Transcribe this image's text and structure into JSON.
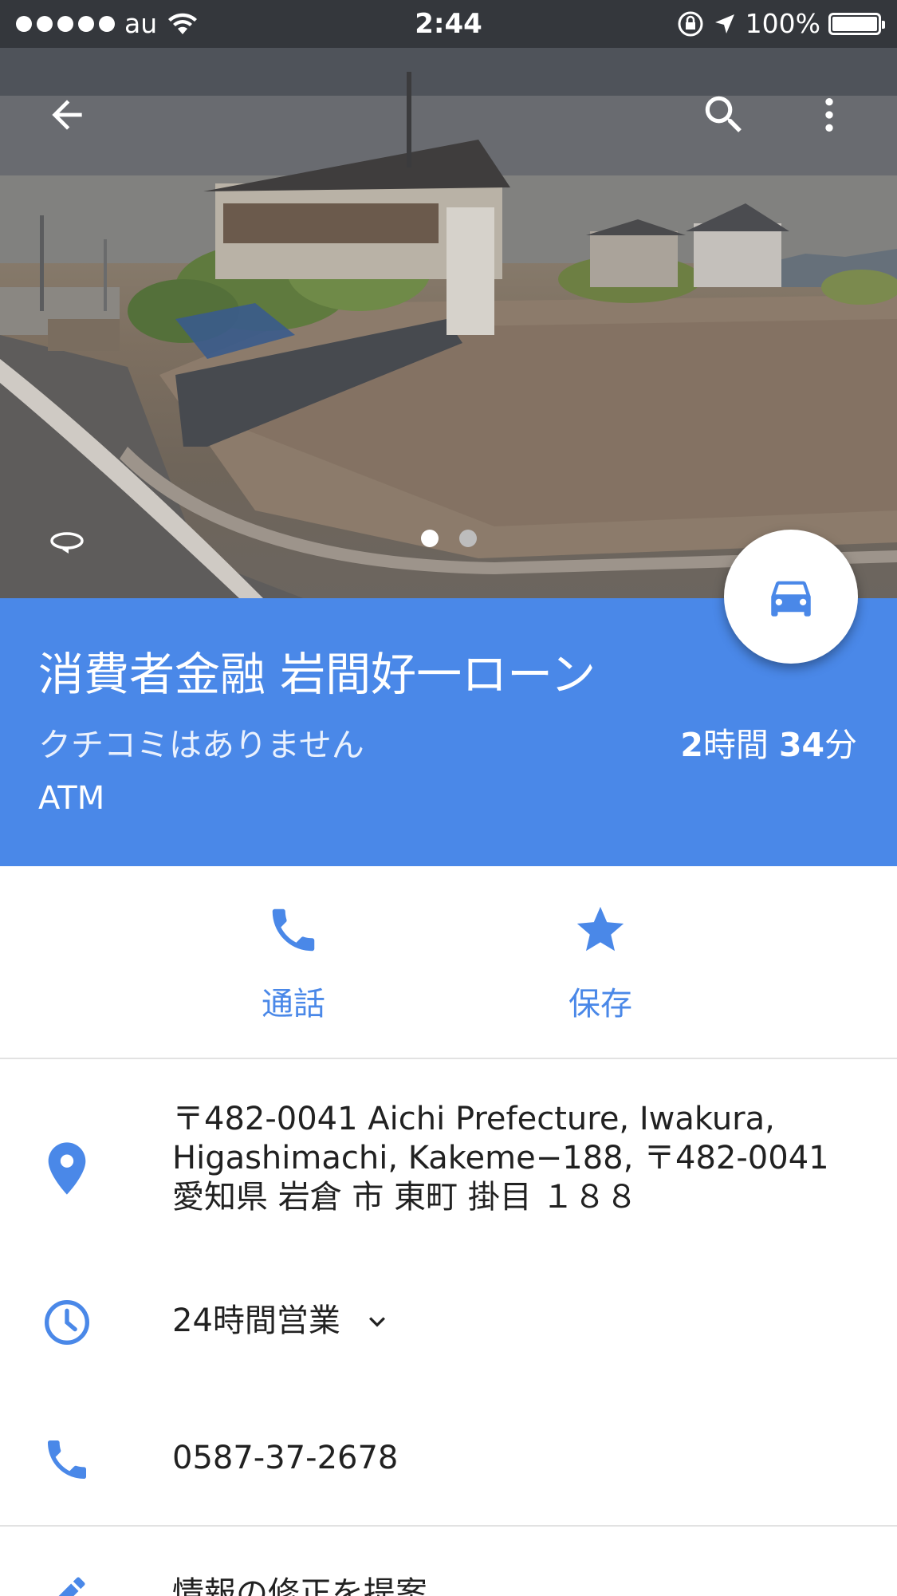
{
  "status_bar": {
    "carrier": "au",
    "time": "2:44",
    "battery_pct": "100%"
  },
  "hero": {
    "page_count": 2,
    "active_page": 0,
    "dot_active_color": "#ffffff",
    "dot_inactive_color": "#bdbdbd"
  },
  "icons": {
    "back": "arrow-back-icon",
    "search": "search-icon",
    "more": "more-vert-icon",
    "rotate": "360-rotate-icon",
    "directions": "car-icon",
    "call": "phone-icon",
    "save": "star-icon",
    "address": "location-pin-icon",
    "hours": "clock-icon",
    "phone": "phone-icon",
    "suggest": "pencil-icon"
  },
  "place": {
    "title": "消費者金融 岩間好一ローン",
    "reviews": "クチコミはありません",
    "eta_hours": "2",
    "eta_hours_unit": "時間",
    "eta_minutes": "34",
    "eta_minutes_unit": "分",
    "category": "ATM"
  },
  "actions": {
    "call_label": "通話",
    "save_label": "保存"
  },
  "info": {
    "address": "〒482-0041 Aichi Prefecture, Iwakura, Higashimachi, Kakeme−188, 〒482-0041 愛知県 岩倉 市 東町 掛目 １８８",
    "hours": "24時間営業",
    "phone": "0587-37-2678",
    "suggest_edit": "情報の修正を提案"
  },
  "colors": {
    "accent": "#4a88e8",
    "header_bg": "#4a88e8",
    "text_primary": "#212121",
    "divider": "#e2e2e2"
  }
}
